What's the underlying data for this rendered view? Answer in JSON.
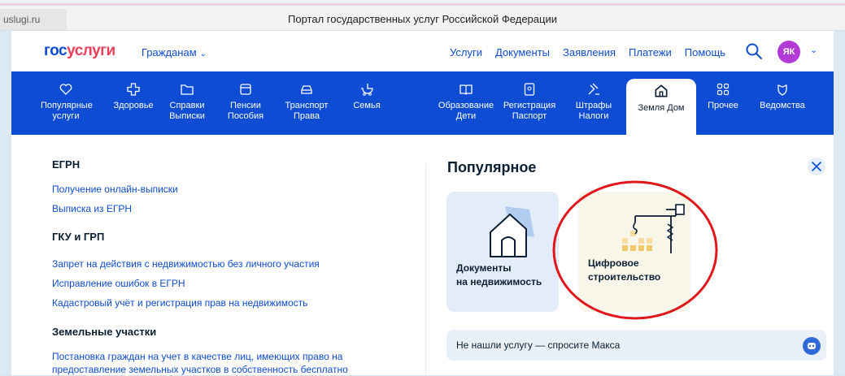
{
  "browser": {
    "url": "uslugi.ru",
    "title": "Портал государственных услуг Российской Федерации"
  },
  "header": {
    "logo_part1": "гос",
    "logo_part2": "услуги",
    "citizens_label": "Гражданам",
    "nav": [
      "Услуги",
      "Документы",
      "Заявления",
      "Платежи",
      "Помощь"
    ],
    "avatar_initials": "ЯК",
    "accent_color": "#0d4cd3"
  },
  "categories": [
    {
      "line1": "Популярные",
      "line2": "услуги",
      "icon": "heart-icon"
    },
    {
      "line1": "Здоровье",
      "line2": "",
      "icon": "medical-cross-icon"
    },
    {
      "line1": "Справки",
      "line2": "Выписки",
      "icon": "folder-icon"
    },
    {
      "line1": "Пенсии",
      "line2": "Пособия",
      "icon": "wallet-icon"
    },
    {
      "line1": "Транспорт",
      "line2": "Права",
      "icon": "car-icon"
    },
    {
      "line1": "Семья",
      "line2": "",
      "icon": "stroller-icon"
    },
    {
      "line1": "Образование",
      "line2": "Дети",
      "icon": "book-icon"
    },
    {
      "line1": "Регистрация",
      "line2": "Паспорт",
      "icon": "passport-icon"
    },
    {
      "line1": "Штрафы",
      "line2": "Налоги",
      "icon": "gavel-icon"
    },
    {
      "line1": "Земля Дом",
      "line2": "",
      "icon": "house-icon"
    },
    {
      "line1": "Прочее",
      "line2": "",
      "icon": "grid-icon"
    },
    {
      "line1": "Ведомства",
      "line2": "",
      "icon": "emblem-icon"
    }
  ],
  "left": {
    "egrn_title": "ЕГРН",
    "egrn_links": [
      "Получение онлайн-выписки",
      "Выписка из ЕГРН"
    ],
    "gku_title": "ГКУ и ГРП",
    "gku_links": [
      "Запрет на действия с недвижимостью без личного участия",
      "Исправление ошибок в ЕГРН",
      "Кадастровый учёт и регистрация прав на недвижимость"
    ],
    "land_title": "Земельные участки",
    "land_link_line1": "Постановка граждан на учет в качестве лиц, имеющих право на",
    "land_link_line2": "предоставление земельных участков в собственность бесплатно"
  },
  "popular": {
    "title": "Популярное",
    "card1_line1": "Документы",
    "card1_line2": "на недвижимость",
    "card2_line1": "Цифровое",
    "card2_line2": "строительство",
    "help_text": "Не нашли услугу — спросите Макса"
  }
}
